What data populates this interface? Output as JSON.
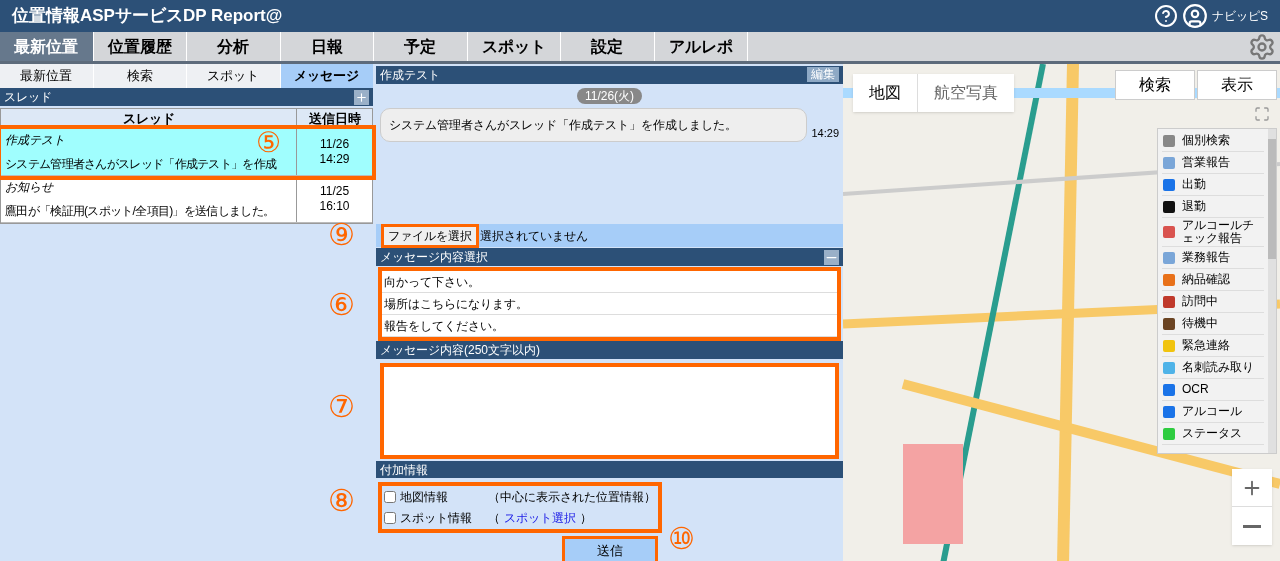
{
  "header": {
    "title": "位置情報ASPサービスDP Report@",
    "user": "ナビッピS"
  },
  "nav_tabs": [
    {
      "label": "最新位置",
      "selected": true
    },
    {
      "label": "位置履歴",
      "selected": false
    },
    {
      "label": "分析",
      "selected": false
    },
    {
      "label": "日報",
      "selected": false
    },
    {
      "label": "予定",
      "selected": false
    },
    {
      "label": "スポット",
      "selected": false
    },
    {
      "label": "設定",
      "selected": false
    },
    {
      "label": "アルレポ",
      "selected": false
    }
  ],
  "sub_tabs": [
    {
      "label": "最新位置",
      "selected": false
    },
    {
      "label": "検索",
      "selected": false
    },
    {
      "label": "スポット",
      "selected": false
    },
    {
      "label": "メッセージ",
      "selected": true
    }
  ],
  "thread_panel": {
    "title": "スレッド",
    "columns": [
      "スレッド",
      "送信日時"
    ],
    "rows": [
      {
        "title": "作成テスト",
        "message": "システム管理者さんがスレッド「作成テスト」を作成",
        "date": "11/26",
        "time": "14:29",
        "selected": true
      },
      {
        "title": "お知らせ",
        "message": "鷹田が「検証用(スポット/全項目)」を送信しました。",
        "date": "11/25",
        "time": "16:10",
        "selected": false
      }
    ]
  },
  "chat": {
    "title": "作成テスト",
    "edit_button": "編集",
    "date": "11/26(火)",
    "messages": [
      {
        "text": "システム管理者さんがスレッド「作成テスト」を作成しました。",
        "time": "14:29"
      }
    ]
  },
  "file": {
    "button": "ファイルを選択",
    "status": "選択されていません"
  },
  "templates": {
    "title": "メッセージ内容選択",
    "items": [
      "向かって下さい。",
      "場所はこちらになります。",
      "報告をしてください。"
    ]
  },
  "message": {
    "title": "メッセージ内容(250文字以内)"
  },
  "extra": {
    "title": "付加情報",
    "options": [
      {
        "label": "地図情報",
        "before": "（中心に表示された位置情報）",
        "checked": false
      },
      {
        "label": "スポット情報",
        "before": "（",
        "link": "スポット選択",
        "after": "）",
        "checked": false
      }
    ]
  },
  "send_button": "送信",
  "map": {
    "map_types": [
      {
        "label": "地図",
        "selected": true
      },
      {
        "label": "航空写真",
        "selected": false
      }
    ],
    "buttons": [
      "検索",
      "表示"
    ],
    "legend": [
      "個別検索",
      "営業報告",
      "出勤",
      "退勤",
      "アルコールチェック報告",
      "業務報告",
      "納品確認",
      "訪問中",
      "待機中",
      "緊急連絡",
      "名刺読み取り",
      "OCR",
      "アルコール",
      "ステータス"
    ]
  },
  "annotations": [
    "⑤",
    "⑨",
    "⑥",
    "⑦",
    "⑧",
    "⑩"
  ]
}
